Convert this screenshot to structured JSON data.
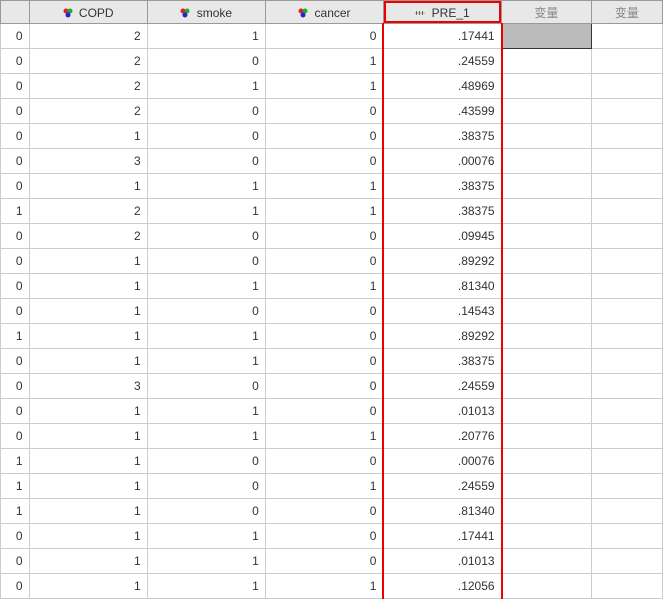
{
  "columns": {
    "c1": "COPD",
    "c2": "smoke",
    "c3": "cancer",
    "c4": "PRE_1",
    "c5": "变量",
    "c6": "变量"
  },
  "rows": [
    {
      "r": "0",
      "copd": "2",
      "smoke": "1",
      "cancer": "0",
      "pre": ".17441"
    },
    {
      "r": "0",
      "copd": "2",
      "smoke": "0",
      "cancer": "1",
      "pre": ".24559"
    },
    {
      "r": "0",
      "copd": "2",
      "smoke": "1",
      "cancer": "1",
      "pre": ".48969"
    },
    {
      "r": "0",
      "copd": "2",
      "smoke": "0",
      "cancer": "0",
      "pre": ".43599"
    },
    {
      "r": "0",
      "copd": "1",
      "smoke": "0",
      "cancer": "0",
      "pre": ".38375"
    },
    {
      "r": "0",
      "copd": "3",
      "smoke": "0",
      "cancer": "0",
      "pre": ".00076"
    },
    {
      "r": "0",
      "copd": "1",
      "smoke": "1",
      "cancer": "1",
      "pre": ".38375"
    },
    {
      "r": "1",
      "copd": "2",
      "smoke": "1",
      "cancer": "1",
      "pre": ".38375"
    },
    {
      "r": "0",
      "copd": "2",
      "smoke": "0",
      "cancer": "0",
      "pre": ".09945"
    },
    {
      "r": "0",
      "copd": "1",
      "smoke": "0",
      "cancer": "0",
      "pre": ".89292"
    },
    {
      "r": "0",
      "copd": "1",
      "smoke": "1",
      "cancer": "1",
      "pre": ".81340"
    },
    {
      "r": "0",
      "copd": "1",
      "smoke": "0",
      "cancer": "0",
      "pre": ".14543"
    },
    {
      "r": "1",
      "copd": "1",
      "smoke": "1",
      "cancer": "0",
      "pre": ".89292"
    },
    {
      "r": "0",
      "copd": "1",
      "smoke": "1",
      "cancer": "0",
      "pre": ".38375"
    },
    {
      "r": "0",
      "copd": "3",
      "smoke": "0",
      "cancer": "0",
      "pre": ".24559"
    },
    {
      "r": "0",
      "copd": "1",
      "smoke": "1",
      "cancer": "0",
      "pre": ".01013"
    },
    {
      "r": "0",
      "copd": "1",
      "smoke": "1",
      "cancer": "1",
      "pre": ".20776"
    },
    {
      "r": "1",
      "copd": "1",
      "smoke": "0",
      "cancer": "0",
      "pre": ".00076"
    },
    {
      "r": "1",
      "copd": "1",
      "smoke": "0",
      "cancer": "1",
      "pre": ".24559"
    },
    {
      "r": "1",
      "copd": "1",
      "smoke": "0",
      "cancer": "0",
      "pre": ".81340"
    },
    {
      "r": "0",
      "copd": "1",
      "smoke": "1",
      "cancer": "0",
      "pre": ".17441"
    },
    {
      "r": "0",
      "copd": "1",
      "smoke": "1",
      "cancer": "0",
      "pre": ".01013"
    },
    {
      "r": "0",
      "copd": "1",
      "smoke": "1",
      "cancer": "1",
      "pre": ".12056"
    }
  ],
  "chart_data": {
    "type": "table",
    "columns": [
      "",
      "COPD",
      "smoke",
      "cancer",
      "PRE_1"
    ],
    "highlighted_column": "PRE_1",
    "data": [
      [
        0,
        2,
        1,
        0,
        0.17441
      ],
      [
        0,
        2,
        0,
        1,
        0.24559
      ],
      [
        0,
        2,
        1,
        1,
        0.48969
      ],
      [
        0,
        2,
        0,
        0,
        0.43599
      ],
      [
        0,
        1,
        0,
        0,
        0.38375
      ],
      [
        0,
        3,
        0,
        0,
        0.00076
      ],
      [
        0,
        1,
        1,
        1,
        0.38375
      ],
      [
        1,
        2,
        1,
        1,
        0.38375
      ],
      [
        0,
        2,
        0,
        0,
        0.09945
      ],
      [
        0,
        1,
        0,
        0,
        0.89292
      ],
      [
        0,
        1,
        1,
        1,
        0.8134
      ],
      [
        0,
        1,
        0,
        0,
        0.14543
      ],
      [
        1,
        1,
        1,
        0,
        0.89292
      ],
      [
        0,
        1,
        1,
        0,
        0.38375
      ],
      [
        0,
        3,
        0,
        0,
        0.24559
      ],
      [
        0,
        1,
        1,
        0,
        0.01013
      ],
      [
        0,
        1,
        1,
        1,
        0.20776
      ],
      [
        1,
        1,
        0,
        0,
        0.00076
      ],
      [
        1,
        1,
        0,
        1,
        0.24559
      ],
      [
        1,
        1,
        0,
        0,
        0.8134
      ],
      [
        0,
        1,
        1,
        0,
        0.17441
      ],
      [
        0,
        1,
        1,
        0,
        0.01013
      ],
      [
        0,
        1,
        1,
        1,
        0.12056
      ]
    ]
  }
}
